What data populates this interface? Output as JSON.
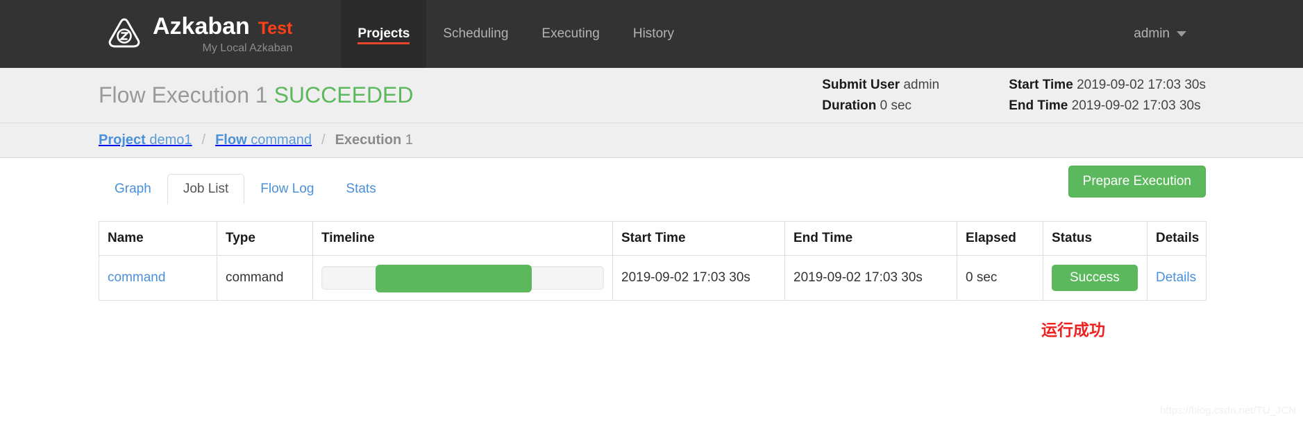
{
  "navbar": {
    "logo_icon": "azkaban-triangle-z-logo",
    "brand_name": "Azkaban",
    "brand_suffix": "Test",
    "brand_subtitle": "My Local Azkaban",
    "links": [
      {
        "label": "Projects",
        "active": true
      },
      {
        "label": "Scheduling",
        "active": false
      },
      {
        "label": "Executing",
        "active": false
      },
      {
        "label": "History",
        "active": false
      }
    ],
    "user": "admin",
    "caret_icon": "chevron-down-icon",
    "bg_color": "#333333",
    "active_underline_color": "#e8462a",
    "brand_suffix_color": "#ff4016"
  },
  "exec_header": {
    "title_prefix": "Flow Execution 1",
    "status": "SUCCEEDED",
    "status_color": "#5cb85c",
    "meta": [
      {
        "label": "Submit User",
        "value": "admin"
      },
      {
        "label": "Duration",
        "value": "0 sec"
      },
      {
        "label": "Start Time",
        "value": "2019-09-02 17:03 30s"
      },
      {
        "label": "End Time",
        "value": "2019-09-02 17:03 30s"
      }
    ]
  },
  "breadcrumb": [
    {
      "label": "Project",
      "value": "demo1",
      "current": false
    },
    {
      "label": "Flow",
      "value": "command",
      "current": false
    },
    {
      "label": "Execution",
      "value": "1",
      "current": true
    }
  ],
  "breadcrumb_separator": "/",
  "tabs": [
    {
      "label": "Graph",
      "active": false
    },
    {
      "label": "Job List",
      "active": true
    },
    {
      "label": "Flow Log",
      "active": false
    },
    {
      "label": "Stats",
      "active": false
    }
  ],
  "actions": {
    "prepare_execution": "Prepare Execution",
    "prepare_color": "#5cb85c"
  },
  "table": {
    "columns": [
      "Name",
      "Type",
      "Timeline",
      "Start Time",
      "End Time",
      "Elapsed",
      "Status",
      "Details"
    ],
    "rows": [
      {
        "name": "command",
        "type": "command",
        "timeline": {
          "start_pct": 19,
          "width_pct": 55.5,
          "color": "#5cb85c"
        },
        "start_time": "2019-09-02 17:03 30s",
        "end_time": "2019-09-02 17:03 30s",
        "elapsed": "0 sec",
        "status": "Success",
        "status_color": "#5cb85c",
        "details": "Details"
      }
    ]
  },
  "annotation": {
    "text": "运行成功",
    "color": "#f02020"
  },
  "watermark": "https://blog.csdn.net/TU_JCN"
}
